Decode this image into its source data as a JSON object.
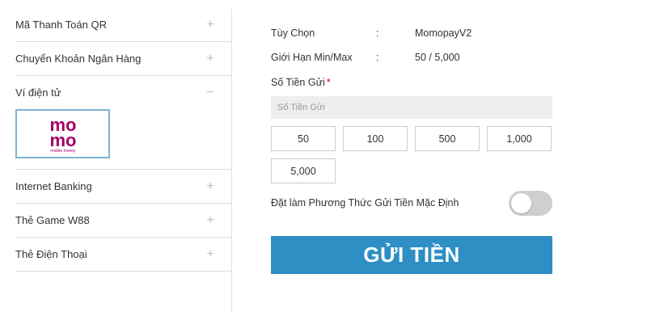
{
  "sidebar": {
    "items": [
      {
        "label": "Mã Thanh Toán QR",
        "toggle": "+"
      },
      {
        "label": "Chuyển Khoản Ngân Hàng",
        "toggle": "+"
      },
      {
        "label": "Ví điện tử",
        "toggle": "−"
      },
      {
        "label": "Internet Banking",
        "toggle": "+"
      },
      {
        "label": "Thẻ Game W88",
        "toggle": "+"
      },
      {
        "label": "Thẻ Điện Thoại",
        "toggle": "+"
      }
    ],
    "momo_logo": {
      "text_top": "mo",
      "text_bottom": "mo",
      "tagline": "mobile money",
      "color": "#a50064"
    }
  },
  "main": {
    "option_label": "Tùy Chọn",
    "option_sep": ":",
    "option_value": "MomopayV2",
    "limit_label": "Giới Hạn Min/Max",
    "limit_sep": ":",
    "limit_value": "50 / 5,000",
    "amount_label": "Số Tiền Gửi",
    "required_mark": "*",
    "amount_placeholder": "Số Tiền Gửi",
    "amount_options": [
      "50",
      "100",
      "500",
      "1,000",
      "5,000"
    ],
    "default_method_label": "Đặt làm Phương Thức Gửi Tiền Mặc Định",
    "submit_label": "GỬI TIỀN",
    "accent_color": "#2d8fc4"
  }
}
